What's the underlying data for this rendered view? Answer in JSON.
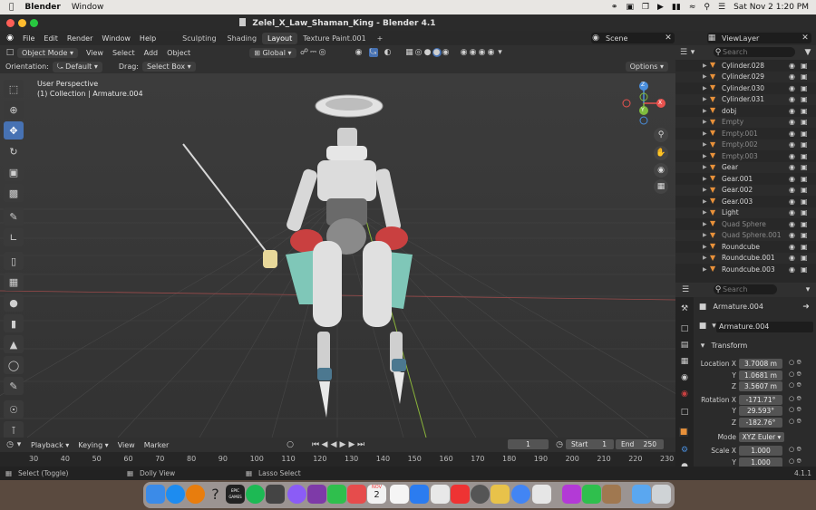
{
  "mac_menu": {
    "apple_icon": "apple-logo-icon",
    "app_name": "Blender",
    "items": [
      "Window"
    ],
    "clock": "Sat Nov 2  1:20 PM"
  },
  "window": {
    "title": "Zelel_X_Law_Shaman_King - Blender 4.1"
  },
  "topbar": {
    "menus": [
      "File",
      "Edit",
      "Render",
      "Window",
      "Help"
    ],
    "workspaces": [
      "Sculpting",
      "Shading",
      "Layout",
      "Texture Paint.001"
    ],
    "active_workspace": "Layout",
    "add_tab": "+",
    "scene": "Scene",
    "view_layer": "ViewLayer"
  },
  "viewport_header": {
    "mode": "Object Mode",
    "menus": [
      "View",
      "Select",
      "Add",
      "Object"
    ],
    "transform_orientation": "Global",
    "options": "Options"
  },
  "tool_settings": {
    "orientation_label": "Orientation:",
    "orientation_value": "Default",
    "drag_label": "Drag:",
    "drag_value": "Select Box"
  },
  "viewport": {
    "perspective": "User Perspective",
    "collection_info": "(1) Collection | Armature.004",
    "gizmo": {
      "x": "X",
      "y": "Y",
      "z": "Z"
    }
  },
  "outliner": {
    "search_placeholder": "Search",
    "items": [
      {
        "name": "Cylinder.028",
        "dim": false
      },
      {
        "name": "Cylinder.029",
        "dim": false
      },
      {
        "name": "Cylinder.030",
        "dim": false
      },
      {
        "name": "Cylinder.031",
        "dim": false
      },
      {
        "name": "dobj",
        "dim": false
      },
      {
        "name": "Empty",
        "dim": true
      },
      {
        "name": "Empty.001",
        "dim": true
      },
      {
        "name": "Empty.002",
        "dim": true
      },
      {
        "name": "Empty.003",
        "dim": true
      },
      {
        "name": "Gear",
        "dim": false
      },
      {
        "name": "Gear.001",
        "dim": false
      },
      {
        "name": "Gear.002",
        "dim": false
      },
      {
        "name": "Gear.003",
        "dim": false
      },
      {
        "name": "Light",
        "dim": false
      },
      {
        "name": "Quad Sphere",
        "dim": true
      },
      {
        "name": "Quad Sphere.001",
        "dim": true
      },
      {
        "name": "Roundcube",
        "dim": false
      },
      {
        "name": "Roundcube.001",
        "dim": false
      },
      {
        "name": "Roundcube.003",
        "dim": false
      }
    ]
  },
  "properties": {
    "search_placeholder": "Search",
    "object_name": "Armature.004",
    "datablock": "Armature.004",
    "transform_header": "Transform",
    "location": {
      "label": "Location X",
      "x": "3.7008 m",
      "y": "1.0681 m",
      "z": "3.5607 m"
    },
    "rotation": {
      "label": "Rotation X",
      "x": "-171.71°",
      "y": "29.593°",
      "z": "-182.76°"
    },
    "axis_y": "Y",
    "axis_z": "Z",
    "mode_label": "Mode",
    "mode_value": "XYZ Euler",
    "scale": {
      "label": "Scale X",
      "x": "1.000",
      "y": "1.000"
    }
  },
  "timeline": {
    "menus": [
      "Playback",
      "Keying",
      "View",
      "Marker"
    ],
    "current_frame": "1",
    "start_label": "Start",
    "start": "1",
    "end_label": "End",
    "end": "250",
    "ruler": [
      "30",
      "40",
      "50",
      "60",
      "70",
      "80",
      "90",
      "100",
      "110",
      "120",
      "130",
      "140",
      "150",
      "160",
      "170",
      "180",
      "190",
      "200",
      "210",
      "220",
      "230"
    ]
  },
  "statusbar": {
    "left": "Select (Toggle)",
    "middle": "Dolly View",
    "right": "Lasso Select",
    "version": "4.1.1"
  },
  "dock": {
    "calendar_month": "NOV",
    "calendar_day": "2",
    "epic_label": "EPIC GAMES",
    "help_glyph": "?"
  },
  "colors": {
    "accent": "#4772b3",
    "object_orange": "#e8913a",
    "axis_x": "#e8534f",
    "axis_y": "#7fbc3e",
    "axis_z": "#4a8fde"
  }
}
